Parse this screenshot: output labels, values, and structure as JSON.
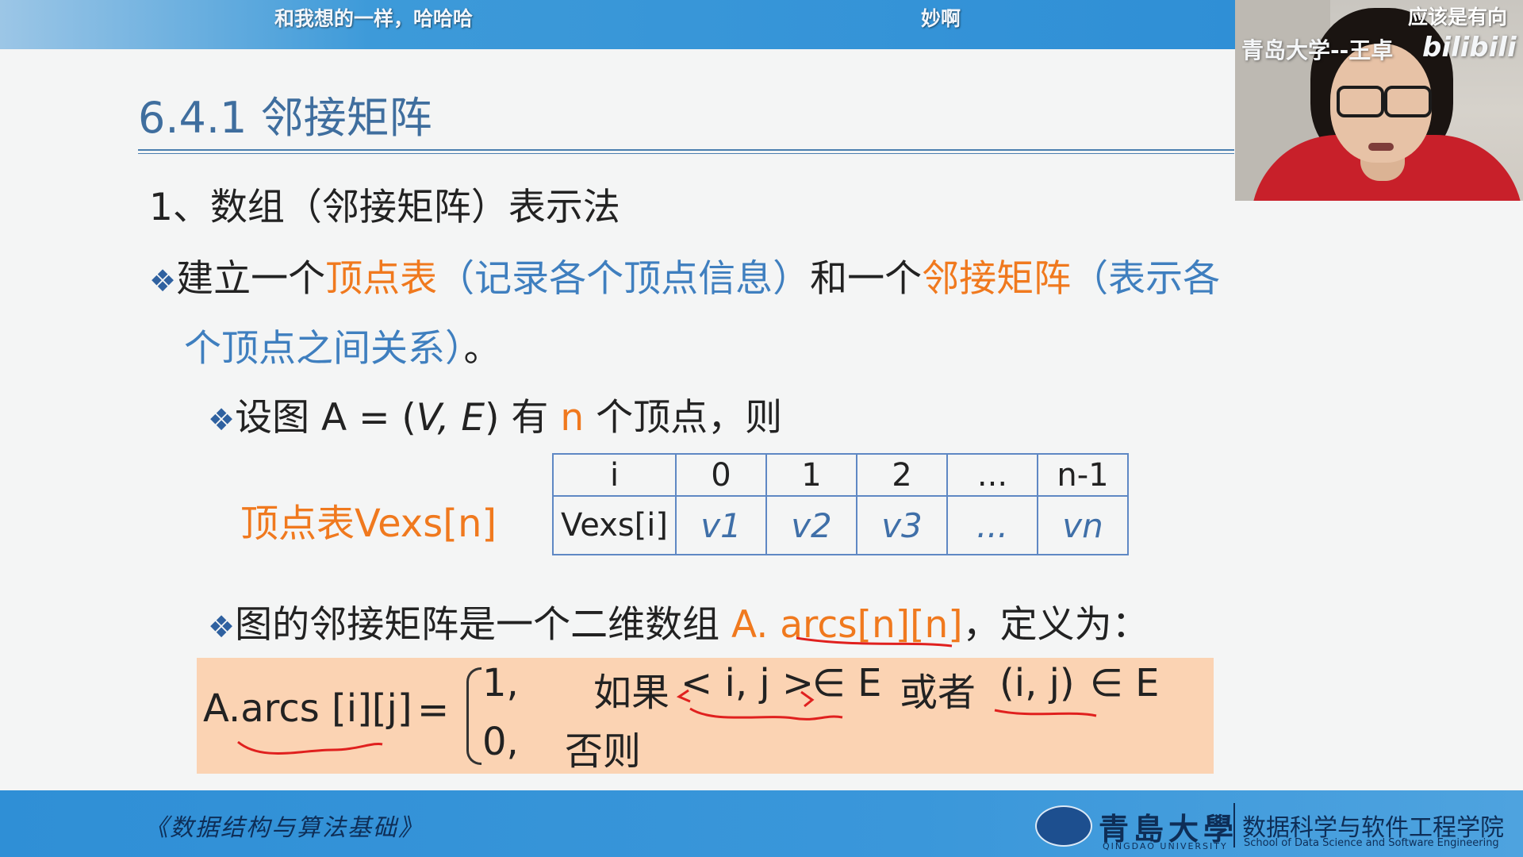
{
  "danmaku": [
    "和我想的一样，哈哈哈",
    "妙啊",
    "应该是有向"
  ],
  "webcam": {
    "watermark": "青岛大学--王卓",
    "logo": "bilibili"
  },
  "slide": {
    "title": "6.4.1 邻接矩阵",
    "subhead": "1、数组（邻接矩阵）表示法",
    "bullet_icon": "diamond-bullet",
    "bullet1": {
      "p1": "建立一个",
      "p2": "顶点表",
      "p3": "（记录各个顶点信息）",
      "p4": "和一个",
      "p5": "邻接矩阵",
      "p6": "（表示各",
      "p7": "个顶点之间关系）",
      "p8": "。"
    },
    "bullet2": {
      "p1": "设图 A = (",
      "p2": "V, E",
      "p3": ") 有 ",
      "p4": "n",
      "p5": " 个顶点，则"
    },
    "vertex_label": "顶点表Vexs[n]",
    "vertex_table": {
      "header": [
        "i",
        "0",
        "1",
        "2",
        "...",
        "n-1"
      ],
      "row": [
        "Vexs[i]",
        "v1",
        "v2",
        "v3",
        "...",
        "vn"
      ]
    },
    "bullet3": {
      "p1": "图的邻接矩阵是一个二维数组 ",
      "p2": "A. arcs[n][n]",
      "p3": "，定义为："
    },
    "formula": {
      "lhs": "A.arcs [i][j]",
      "eq": "=",
      "case1_val": "1,",
      "case1_cond_a": "如果",
      "case1_cond_b": "< i, j >",
      "case1_cond_c": "∈ E",
      "case1_or": "或者",
      "case1_cond_d": "(i, j)",
      "case1_cond_e": "∈ E",
      "case2_val": "0,",
      "case2_cond": "否则"
    }
  },
  "footer": {
    "course": "《数据结构与算法基础》",
    "university": "青島大學",
    "university_en": "QINGDAO UNIVERSITY",
    "school_cn": "数据科学与软件工程学院",
    "school_en": "School of Data Science and Software Engineering"
  },
  "colors": {
    "accent_orange": "#f0791e",
    "title_blue": "#3f6e9e",
    "bar_blue": "#2f8fd6",
    "formula_bg": "#fbd3b3",
    "annotation_red": "#e0201e"
  }
}
